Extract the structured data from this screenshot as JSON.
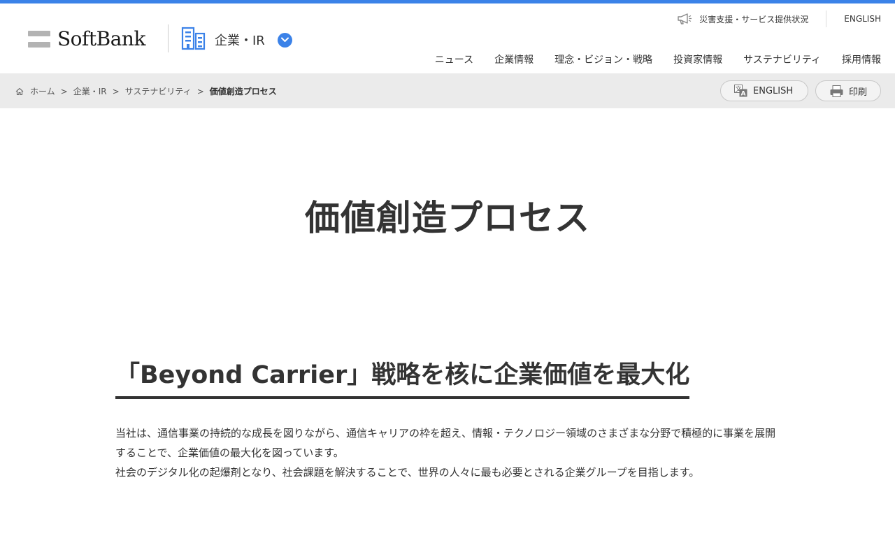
{
  "colors": {
    "accent": "#3b82e8",
    "crumb_bg": "#ebebeb",
    "text": "#333333"
  },
  "header": {
    "logo_text": "SoftBank",
    "section_label": "企業・IR",
    "section_icon": "building-icon",
    "utility": {
      "disaster_link": "災害支援・サービス提供状況",
      "disaster_icon": "megaphone-icon",
      "english_link": "ENGLISH"
    },
    "nav": [
      {
        "label": "ニュース"
      },
      {
        "label": "企業情報"
      },
      {
        "label": "理念・ビジョン・戦略"
      },
      {
        "label": "投資家情報"
      },
      {
        "label": "サステナビリティ"
      },
      {
        "label": "採用情報"
      }
    ]
  },
  "breadcrumb": {
    "home_icon": "home-icon",
    "items": [
      {
        "label": "ホーム"
      },
      {
        "label": "企業・IR"
      },
      {
        "label": "サステナビリティ"
      }
    ],
    "separator": ">",
    "current": "価値創造プロセス"
  },
  "tools": {
    "english_label": "ENGLISH",
    "english_icon": "translate-icon",
    "print_label": "印刷",
    "print_icon": "printer-icon"
  },
  "main": {
    "title": "価値創造プロセス",
    "heading": "「Beyond Carrier」戦略を核に企業価値を最大化",
    "paragraph1": "当社は、通信事業の持続的な成長を図りながら、通信キャリアの枠を超え、情報・テクノロジー領域のさまざまな分野で積極的に事業を展開することで、企業価値の最大化を図っています。",
    "paragraph2": "社会のデジタル化の起爆剤となり、社会課題を解決することで、世界の人々に最も必要とされる企業グループを目指します。"
  }
}
